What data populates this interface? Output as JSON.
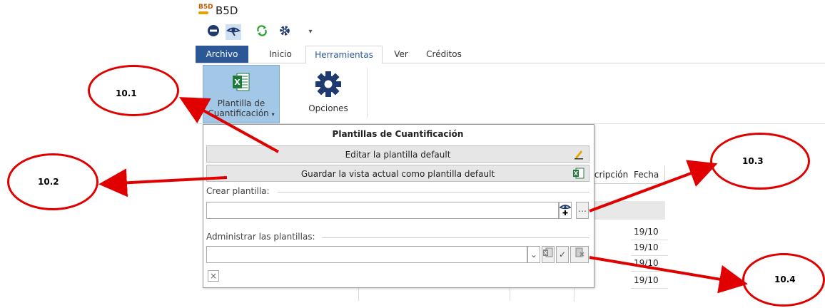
{
  "app": {
    "logo_text": "B5D",
    "title": "B5D"
  },
  "tabs": {
    "archivo": "Archivo",
    "inicio": "Inicio",
    "herramientas": "Herramientas",
    "ver": "Ver",
    "creditos": "Créditos"
  },
  "ribbon": {
    "plantilla_line1": "Plantilla de",
    "plantilla_line2": "Cuantificación",
    "opciones": "Opciones"
  },
  "grid": {
    "col_descripcion": "Descripción",
    "col_fecha": "Fecha",
    "dates": [
      "19/10",
      "19/10",
      "19/10",
      "19/10"
    ]
  },
  "popup": {
    "title": "Plantillas de Cuantificación",
    "edit_default": "Editar la plantilla default",
    "save_default": "Guardar la vista actual como plantilla default",
    "create_label": "Crear plantilla:",
    "create_value": "",
    "manage_label": "Administrar las plantillas:",
    "manage_value": ""
  },
  "callouts": {
    "c1": "10.1",
    "c2": "10.2",
    "c3": "10.3",
    "c4": "10.4"
  },
  "colors": {
    "archivo_tab": "#2b5797",
    "ribbon_selected": "#a3c8e7",
    "callout_red": "#e00000"
  }
}
